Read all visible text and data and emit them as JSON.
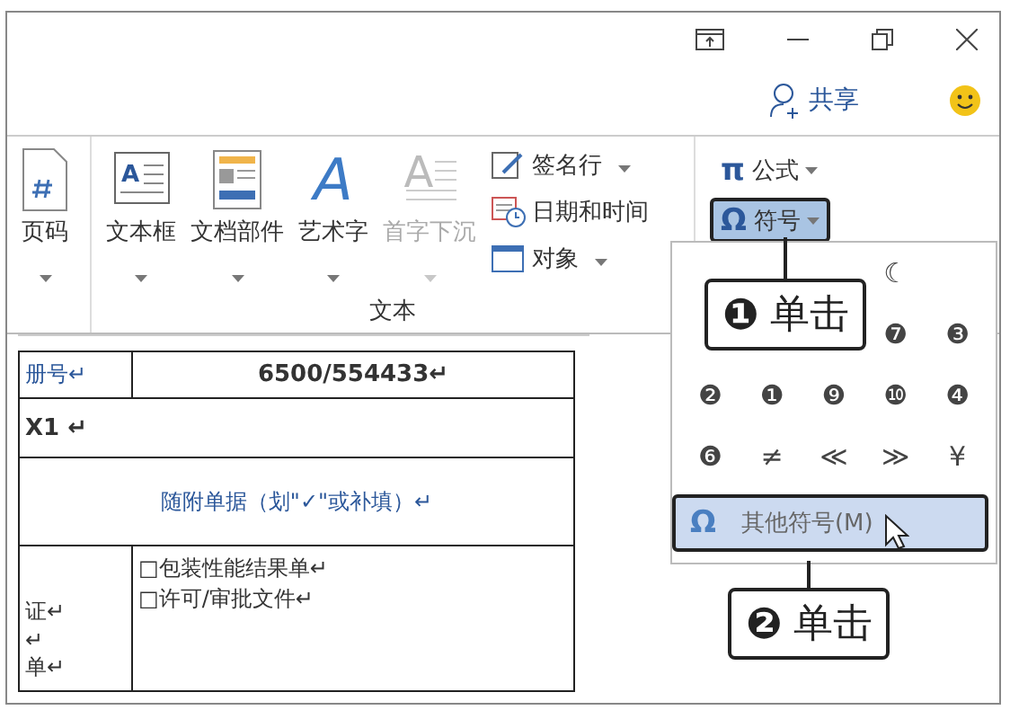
{
  "account": {
    "share": "共享"
  },
  "ribbon": {
    "page_number": {
      "label": "页码"
    },
    "text_group": {
      "label": "文本",
      "large": [
        {
          "kind": "textbox",
          "glyph": "A",
          "label": "文本框",
          "disabled": false
        },
        {
          "kind": "parts",
          "label": "文档部件",
          "disabled": false
        },
        {
          "kind": "wordart",
          "glyph": "A",
          "label": "艺术字",
          "disabled": false
        },
        {
          "kind": "dropcap",
          "glyph": "A",
          "label": "首字下沉",
          "disabled": true
        }
      ],
      "small": [
        {
          "kind": "signature",
          "label": "签名行",
          "menu": true
        },
        {
          "kind": "datetime",
          "label": "日期和时间",
          "menu": false
        },
        {
          "kind": "object",
          "label": "对象",
          "menu": true
        }
      ]
    },
    "symbols": [
      {
        "glyph": "π",
        "label": "公式",
        "selected": false
      },
      {
        "glyph": "Ω",
        "label": "符号",
        "selected": true
      }
    ]
  },
  "symbol_menu": {
    "rows": [
      [
        "",
        "",
        "",
        "☾"
      ],
      [
        "",
        "",
        "",
        "❼",
        "❸"
      ],
      [
        "❷",
        "❶",
        "❾",
        "❿",
        "❹"
      ],
      [
        "❻",
        "≠",
        "≪",
        "≫",
        "¥"
      ]
    ],
    "more": {
      "glyph": "Ω",
      "label": "其他符号(M)",
      "selected": true
    }
  },
  "callouts": [
    {
      "number": "❶",
      "text": "单击"
    },
    {
      "number": "❷",
      "text": "单击"
    }
  ],
  "document": {
    "rows": [
      {
        "cells": [
          {
            "kind": "label",
            "lines": [
              "册号↵"
            ]
          },
          {
            "kind": "value",
            "lines": [
              "6500/554433↵"
            ]
          }
        ]
      },
      {
        "cells": [
          {
            "kind": "code",
            "colspan": 2,
            "lines": [
              "X1 ↵"
            ]
          }
        ]
      },
      {
        "cells": [
          {
            "kind": "heading",
            "colspan": 2,
            "lines": [
              "随附单据（划\"✓\"或补填）↵"
            ]
          }
        ]
      },
      {
        "cells": [
          {
            "kind": "note",
            "lines": [
              "证↵",
              "↵",
              "单↵"
            ]
          },
          {
            "kind": "list",
            "lines": [
              "□包装性能结果单↵",
              "□许可/审批文件↵"
            ]
          }
        ]
      }
    ]
  }
}
